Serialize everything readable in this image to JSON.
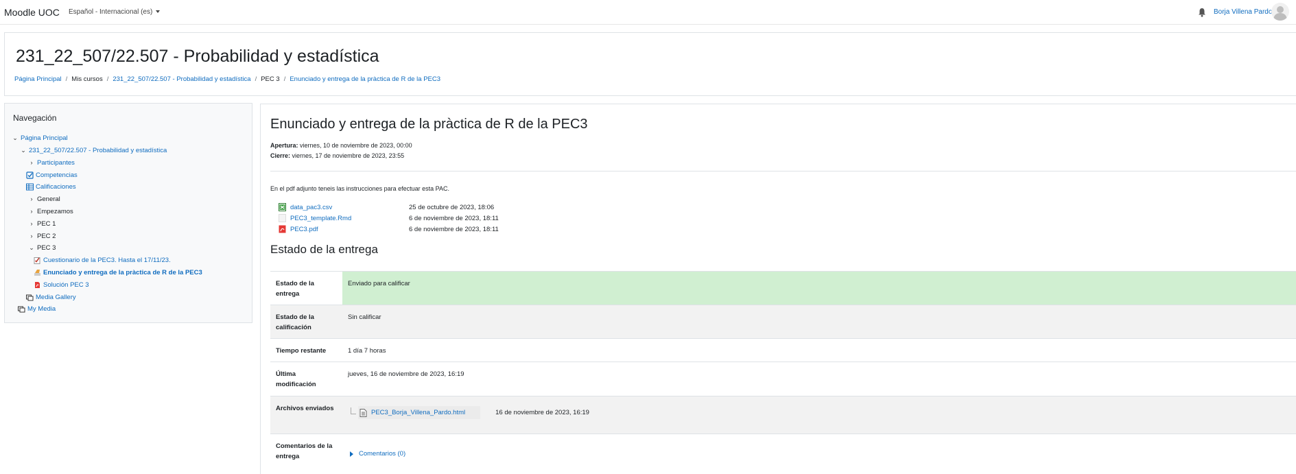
{
  "navbar": {
    "brand": "Moodle UOC",
    "language": "Español - Internacional (es)",
    "user_name": "Borja Villena Pardo"
  },
  "header": {
    "title": "231_22_507/22.507 - Probabilidad y estadística",
    "breadcrumb": [
      "Página Principal",
      "Mis cursos",
      "231_22_507/22.507 - Probabilidad y estadística",
      "PEC 3",
      "Enunciado y entrega de la pràctica de R de la PEC3"
    ]
  },
  "navigation": {
    "title": "Navegación",
    "items": [
      {
        "label": "Página Principal",
        "icon": "chevron-down-icon"
      },
      {
        "label": "231_22_507/22.507 - Probabilidad y estadística",
        "icon": "chevron-down-icon"
      },
      {
        "label": "Participantes",
        "icon": "chevron-right-icon"
      },
      {
        "label": "Competencias",
        "icon": "checkbox-icon"
      },
      {
        "label": "Calificaciones",
        "icon": "table-icon"
      },
      {
        "label": "General",
        "icon": "chevron-right-icon"
      },
      {
        "label": "Empezamos",
        "icon": "chevron-right-icon"
      },
      {
        "label": "PEC 1",
        "icon": "chevron-right-icon"
      },
      {
        "label": "PEC 2",
        "icon": "chevron-right-icon"
      },
      {
        "label": "PEC 3",
        "icon": "chevron-down-icon"
      },
      {
        "label": "Cuestionario de la PEC3. Hasta el 17/11/23.",
        "icon": "quiz-icon"
      },
      {
        "label": "Enunciado y entrega de la pràctica de R de la PEC3",
        "icon": "assignment-icon"
      },
      {
        "label": "Solución PEC 3",
        "icon": "pdf-icon"
      },
      {
        "label": "Media Gallery",
        "icon": "media-gallery-icon"
      },
      {
        "label": "My Media",
        "icon": "media-gallery-icon"
      }
    ]
  },
  "activity": {
    "title": "Enunciado y entrega de la pràctica de R de la PEC3",
    "opening_label": "Apertura:",
    "opening_value": "viernes, 10 de noviembre de 2023, 00:00",
    "closing_label": "Cierre:",
    "closing_value": "viernes, 17 de noviembre de 2023, 23:55",
    "intro": "En el pdf adjunto teneis las instrucciones para efectuar esta PAC.",
    "files": [
      {
        "name": "data_pac3.csv",
        "date": "25 de octubre de 2023, 18:06",
        "icon": "spreadsheet-icon"
      },
      {
        "name": "PEC3_template.Rmd",
        "date": "6 de noviembre de 2023, 18:11",
        "icon": "text-file-icon"
      },
      {
        "name": "PEC3.pdf",
        "date": "6 de noviembre de 2023, 18:11",
        "icon": "pdf-icon"
      }
    ]
  },
  "submission": {
    "title": "Estado de la entrega",
    "rows": {
      "status_label": "Estado de la entrega",
      "status_value": "Enviado para calificar",
      "grading_label": "Estado de la calificación",
      "grading_value": "Sin calificar",
      "time_label": "Tiempo restante",
      "time_value": "1 día 7 horas",
      "modified_label": "Última modificación",
      "modified_value": "jueves, 16 de noviembre de 2023, 16:19",
      "files_label": "Archivos enviados",
      "file_name": "PEC3_Borja_Villena_Pardo.html",
      "file_date": "16 de noviembre de 2023, 16:19",
      "comments_label": "Comentarios de la entrega",
      "comments_link": "Comentarios (0)"
    },
    "colors": {
      "submitted": "#d0efd1",
      "striped": "#f2f2f2",
      "link": "#0f6cbf"
    }
  }
}
